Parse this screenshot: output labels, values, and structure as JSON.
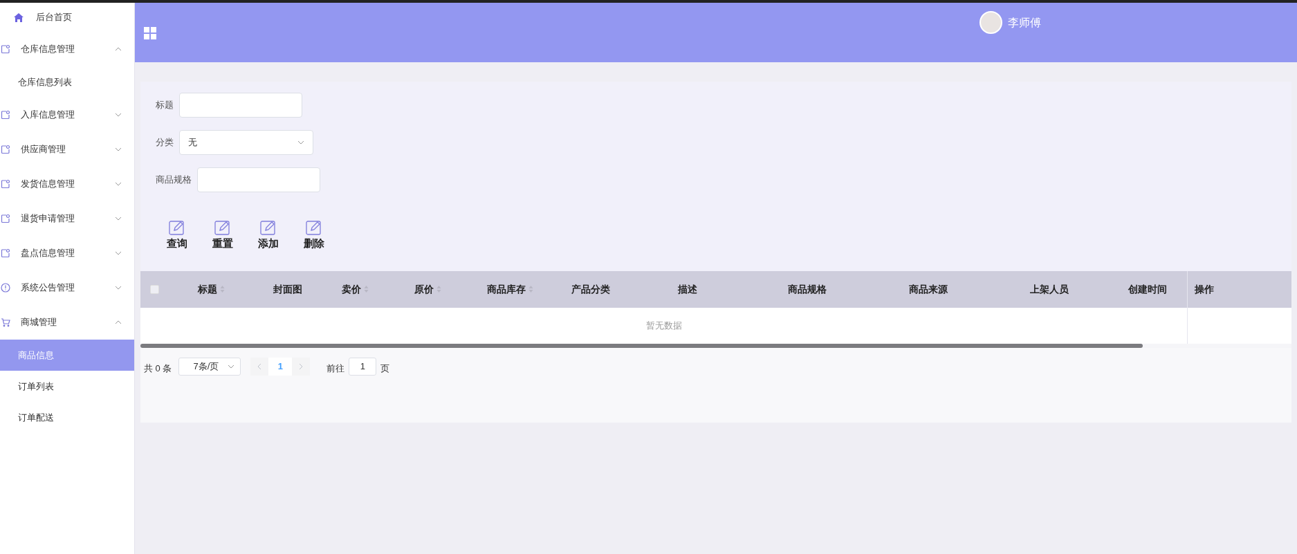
{
  "sidebar": {
    "items": [
      {
        "label": "后台首页",
        "kind": "home"
      },
      {
        "label": "仓库信息管理",
        "kind": "group",
        "expanded": true,
        "children": [
          {
            "label": "仓库信息列表",
            "selected": false
          }
        ]
      },
      {
        "label": "入库信息管理",
        "kind": "group",
        "expanded": false
      },
      {
        "label": "供应商管理",
        "kind": "group",
        "expanded": false
      },
      {
        "label": "发货信息管理",
        "kind": "group",
        "expanded": false
      },
      {
        "label": "退货申请管理",
        "kind": "group",
        "expanded": false
      },
      {
        "label": "盘点信息管理",
        "kind": "group",
        "expanded": false
      },
      {
        "label": "系统公告管理",
        "kind": "group",
        "expanded": false
      },
      {
        "label": "商城管理",
        "kind": "group",
        "expanded": true,
        "children": [
          {
            "label": "商品信息",
            "selected": true
          },
          {
            "label": "订单列表",
            "selected": false
          },
          {
            "label": "订单配送",
            "selected": false
          }
        ]
      }
    ]
  },
  "header": {
    "user": "李师傅"
  },
  "filters": [
    {
      "label": "标题",
      "kind": "input"
    },
    {
      "label": "分类",
      "kind": "select",
      "value": "无"
    },
    {
      "label": "商品规格",
      "kind": "input"
    }
  ],
  "actions": [
    "查询",
    "重置",
    "添加",
    "删除"
  ],
  "table": {
    "all_checked": false,
    "columns": [
      {
        "label": "标题",
        "sortable": true
      },
      {
        "label": "封面图",
        "sortable": false
      },
      {
        "label": "卖价",
        "sortable": true
      },
      {
        "label": "原价",
        "sortable": true
      },
      {
        "label": "商品库存",
        "sortable": true
      },
      {
        "label": "产品分类",
        "sortable": false
      },
      {
        "label": "描述",
        "sortable": false
      },
      {
        "label": "商品规格",
        "sortable": false
      },
      {
        "label": "商品来源",
        "sortable": false
      },
      {
        "label": "上架人员",
        "sortable": false
      },
      {
        "label": "创建时间",
        "sortable": false
      }
    ],
    "fixed_column": "操作",
    "empty_text": "暂无数据"
  },
  "pagination": {
    "total": "共 0 条",
    "page_size": "7条/页",
    "pages": [
      {
        "label": "1",
        "selected": true
      }
    ],
    "goto_label": "前往",
    "goto_value": "1",
    "goto_suffix": "页"
  }
}
